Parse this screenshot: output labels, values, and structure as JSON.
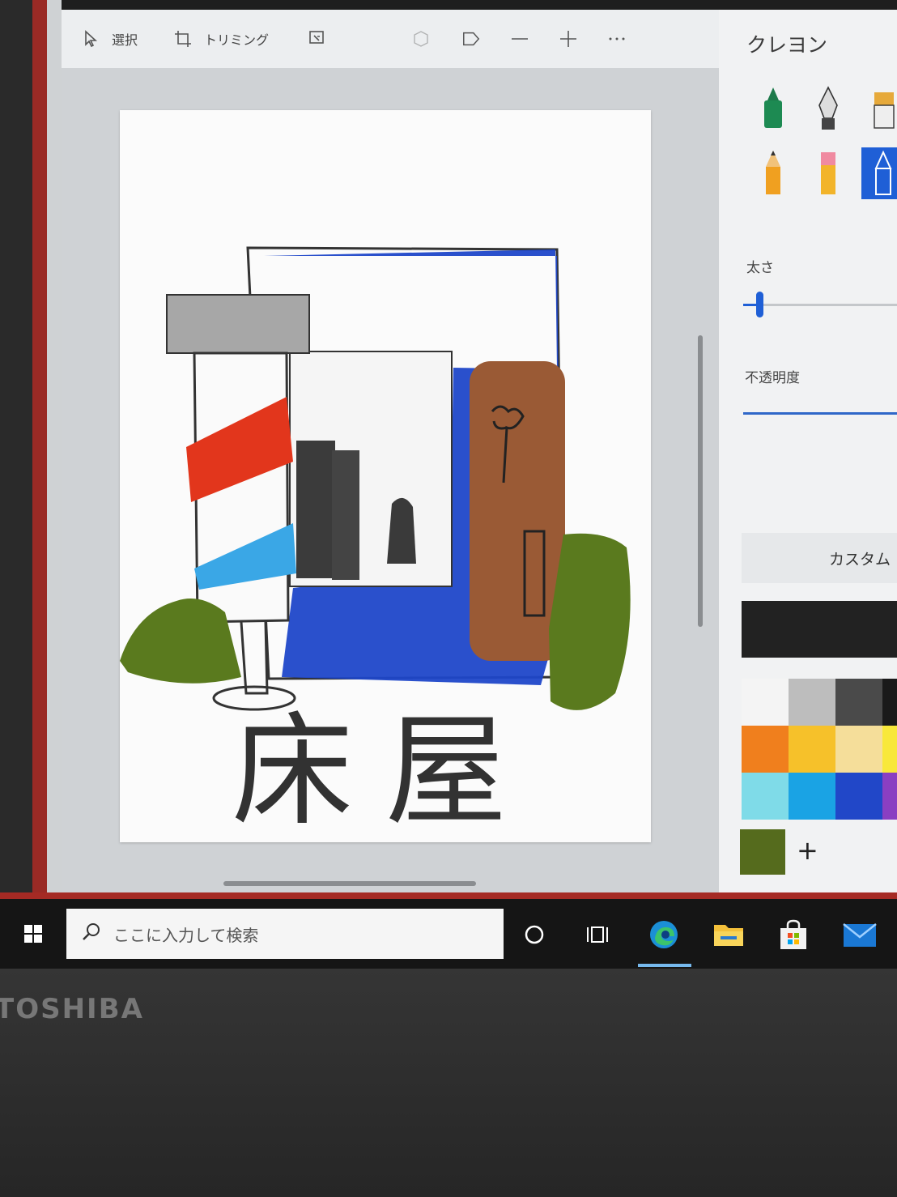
{
  "toolbar": {
    "select_label": "選択",
    "crop_label": "トリミング"
  },
  "panel": {
    "title": "クレヨン",
    "size_label": "太さ",
    "opacity_label": "不透明度",
    "custom_label": "カスタム",
    "add_label": "+",
    "selected_color": "#556b1d",
    "current_color": "#222222",
    "swatches": [
      "#f4f4f4",
      "#bdbdbd",
      "#4a4a4a",
      "#1a1a1a",
      "#f07f1d",
      "#f6c12a",
      "#f5de9a",
      "#f8e83a",
      "#7fdbe8",
      "#1aa3e4",
      "#2147c8",
      "#8a3fc2"
    ]
  },
  "taskbar": {
    "search_placeholder": "ここに入力して検索"
  },
  "drawing": {
    "title_text": "床屋"
  },
  "laptop": {
    "brand": "TOSHIBA"
  }
}
